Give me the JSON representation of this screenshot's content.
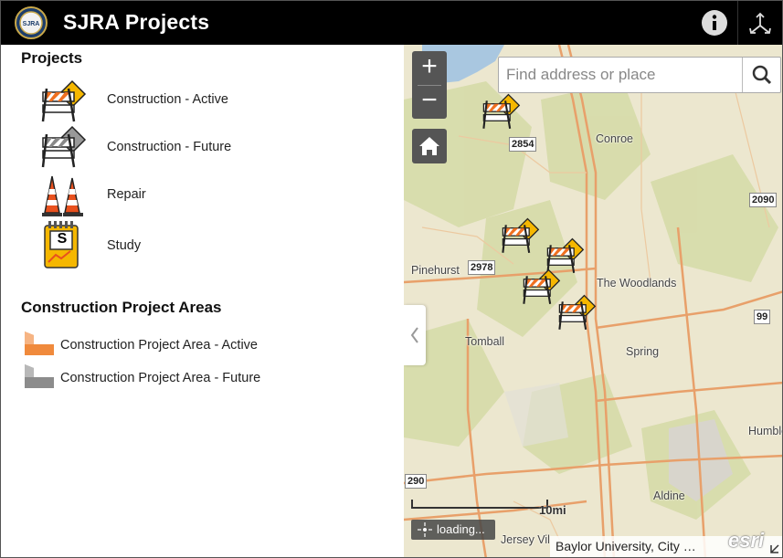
{
  "app": {
    "title": "SJRA Projects",
    "logo_text": "SJRA",
    "icons": {
      "logo": "sjra-seal-logo",
      "info": "info-icon",
      "share": "share-icon"
    }
  },
  "panel": {
    "projects_title": "Projects",
    "projects": [
      {
        "label": "Construction - Active",
        "icon": "barricade-active-icon"
      },
      {
        "label": "Construction - Future",
        "icon": "barricade-future-icon"
      },
      {
        "label": "Repair",
        "icon": "traffic-cones-icon"
      },
      {
        "label": "Study",
        "icon": "study-notepad-icon",
        "icon_text": "S"
      }
    ],
    "areas_title": "Construction Project Areas",
    "areas": [
      {
        "label": "Construction Project Area - Active",
        "icon": "area-active-icon",
        "color": "#f08a3c"
      },
      {
        "label": "Construction Project Area - Future",
        "icon": "area-future-icon",
        "color": "#9a9a9a"
      }
    ]
  },
  "map": {
    "zoom_in": "+",
    "zoom_out": "−",
    "search_placeholder": "Find address or place",
    "places": [
      "Conroe",
      "Pinehurst",
      "The Woodlands",
      "Tomball",
      "Spring",
      "Humble",
      "Aldine",
      "Jersey Vil"
    ],
    "shields": [
      "2854",
      "2090",
      "2978",
      "99",
      "290"
    ],
    "scale_label": "10mi",
    "loading_text": "loading...",
    "attribution": "Baylor University, City …",
    "esri_logo": "esri",
    "colors": {
      "road": "#e8a06a",
      "land": "#ece7cf",
      "green": "#d8dcae",
      "water": "#a9c7e0"
    }
  }
}
